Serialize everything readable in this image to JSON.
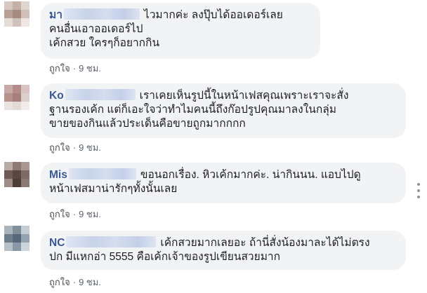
{
  "comments": [
    {
      "author_start": "มา",
      "author_end": "",
      "lines": [
        "ไวมากค่ะ ลงปุ๊บได้ออเดอร์เลย",
        "คนอื่นเอาออเดอร์ไป",
        "เค้กสวย ใครๆก็อยากกิน"
      ],
      "like_label": "ถูกใจ",
      "separator": "·",
      "time": "9 ชม.",
      "avatar_colors": [
        "#d6c7c0",
        "#c4b0a6",
        "#e0d6d0",
        "#b89f94",
        "#a58b80",
        "#cfc0b8",
        "#e6dcd6",
        "#d0c2ba",
        "#ede6e2"
      ]
    },
    {
      "author_start": "Ko",
      "author_end": "",
      "lines": [
        "เราเคยเห็นรูปนี้ในหน้าเฟสคุณเพราะเราจะสั่ง",
        "ฐานรองเค้ก แต่ก็เอะใจว่าทำไมคนนี้ถึงก๊อปรูปคุณมาลงในกลุ่ม",
        "ขายของกินแล้วประเด็นคือขายถูกมากกกก"
      ],
      "like_label": "ถูกใจ",
      "separator": "·",
      "time": "9 ชม.",
      "avatar_colors": [
        "#c9a9a6",
        "#b48c8a",
        "#d8c3c0",
        "#b8908c",
        "#a5807c",
        "#d9cfcc",
        "#e9e2e0",
        "#e3dad7",
        "#f1ecea"
      ]
    },
    {
      "author_start": "Mis",
      "author_end": "",
      "lines": [
        "ขอนอกเรื่อง. หิวเค้กมากค่ะ. น่ากินนน. แอบไปดู",
        "หน้าเฟสมาน่ารักๆทั้งนั้นเลย"
      ],
      "like_label": "ถูกใจ",
      "separator": "·",
      "time": "9 ชม.",
      "avatar_colors": [
        "#b8aaa4",
        "#8d7a72",
        "#a89890",
        "#6c5a55",
        "#5a4742",
        "#7e6b65",
        "#9c8c86",
        "#4e3e3a",
        "#8a7a74"
      ]
    },
    {
      "author_start": "NC",
      "author_end": "",
      "lines": [
        "เค้กสวยมากเลยอะ ถ้านี่สั่งน้องมาละได้ไม่ตรง",
        "ปก มีแหกอ่า 5555 คือเค้กเจ้าของรูปเขียนสวยมาก"
      ],
      "like_label": "ถูกใจ",
      "separator": "·",
      "time": "9 ชม.",
      "avatar_colors": [
        "#a9b4bd",
        "#7f8f9c",
        "#c3ccd3",
        "#6d7f8e",
        "#55697a",
        "#94a3af",
        "#b5c0c8",
        "#8898a6",
        "#cdd5db"
      ]
    }
  ]
}
